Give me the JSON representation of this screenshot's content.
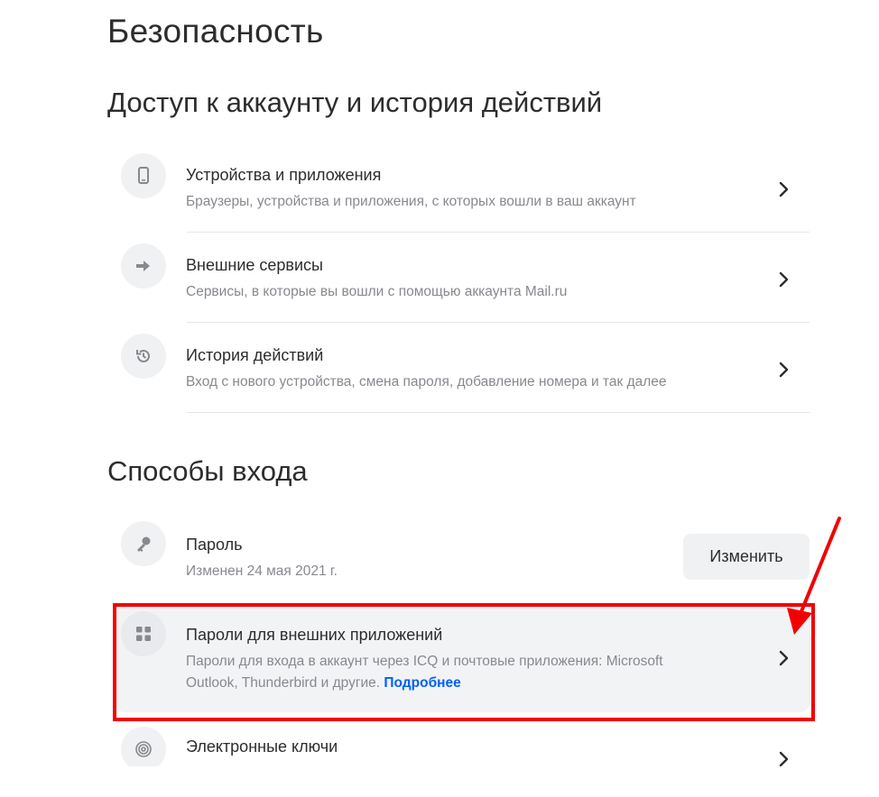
{
  "page_title": "Безопасность",
  "sections": {
    "access": {
      "title": "Доступ к аккаунту и история действий",
      "items": [
        {
          "title": "Устройства и приложения",
          "subtitle": "Браузеры, устройства и приложения, с которых вошли в ваш аккаунт",
          "icon": "phone-icon"
        },
        {
          "title": "Внешние сервисы",
          "subtitle": "Сервисы, в которые вы вошли с помощью аккаунта Mail.ru",
          "icon": "arrow-right-icon"
        },
        {
          "title": "История действий",
          "subtitle": "Вход с нового устройства, смена пароля, добавление номера и так далее",
          "icon": "history-icon"
        }
      ]
    },
    "login": {
      "title": "Способы входа",
      "password": {
        "title": "Пароль",
        "subtitle": "Изменен 24 мая 2021 г.",
        "button": "Изменить",
        "icon": "key-icon"
      },
      "app_passwords": {
        "title": "Пароли для внешних приложений",
        "subtitle_line1": "Пароли для входа в аккаунт через ICQ и почтовые приложения: Microsoft",
        "subtitle_line2": "Outlook, Thunderbird и другие.",
        "link": "Подробнее",
        "icon": "grid-icon"
      },
      "keys": {
        "title": "Электронные ключи",
        "icon": "fingerprint-icon"
      }
    }
  },
  "colors": {
    "accent_link": "#005ff9",
    "highlight_border": "#f20000",
    "text_primary": "#2c2d2e",
    "text_secondary": "#87898f"
  }
}
